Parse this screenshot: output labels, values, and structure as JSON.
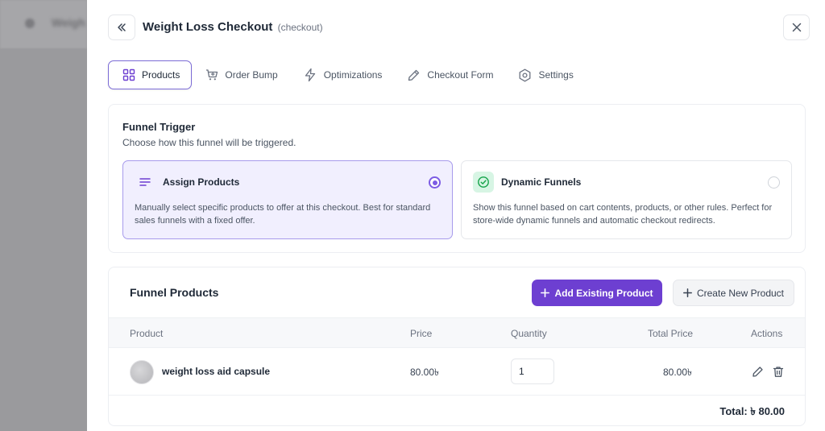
{
  "header": {
    "title": "Weight Loss Checkout",
    "subtitle": "(checkout)"
  },
  "backdrop": {
    "title": "Weigh"
  },
  "tabs": [
    {
      "label": "Products",
      "icon": "grid-icon",
      "active": true
    },
    {
      "label": "Order Bump",
      "icon": "cart-icon",
      "active": false
    },
    {
      "label": "Optimizations",
      "icon": "lightning-icon",
      "active": false
    },
    {
      "label": "Checkout Form",
      "icon": "pen-icon",
      "active": false
    },
    {
      "label": "Settings",
      "icon": "settings-icon",
      "active": false
    }
  ],
  "trigger": {
    "title": "Funnel Trigger",
    "description": "Choose how this funnel will be triggered.",
    "options": [
      {
        "title": "Assign Products",
        "description": "Manually select specific products to offer at this checkout. Best for standard sales funnels with a fixed offer.",
        "selected": true
      },
      {
        "title": "Dynamic Funnels",
        "description": "Show this funnel based on cart contents, products, or other rules. Perfect for store-wide dynamic funnels and automatic checkout redirects.",
        "selected": false
      }
    ]
  },
  "products": {
    "title": "Funnel Products",
    "add_existing_label": "Add Existing Product",
    "create_new_label": "Create New Product",
    "columns": [
      "Product",
      "Price",
      "Quantity",
      "Total Price",
      "Actions"
    ],
    "rows": [
      {
        "name": "weight loss aid capsule",
        "price": "80.00৳",
        "quantity": "1",
        "total": "80.00৳"
      }
    ],
    "total_label": "Total: ৳ 80.00"
  },
  "colors": {
    "accent": "#6d3fd1",
    "selected_bg": "#f1effe",
    "selected_border": "#a79bec",
    "success_bg": "#d7f5e4",
    "success_icon": "#16a34a"
  }
}
